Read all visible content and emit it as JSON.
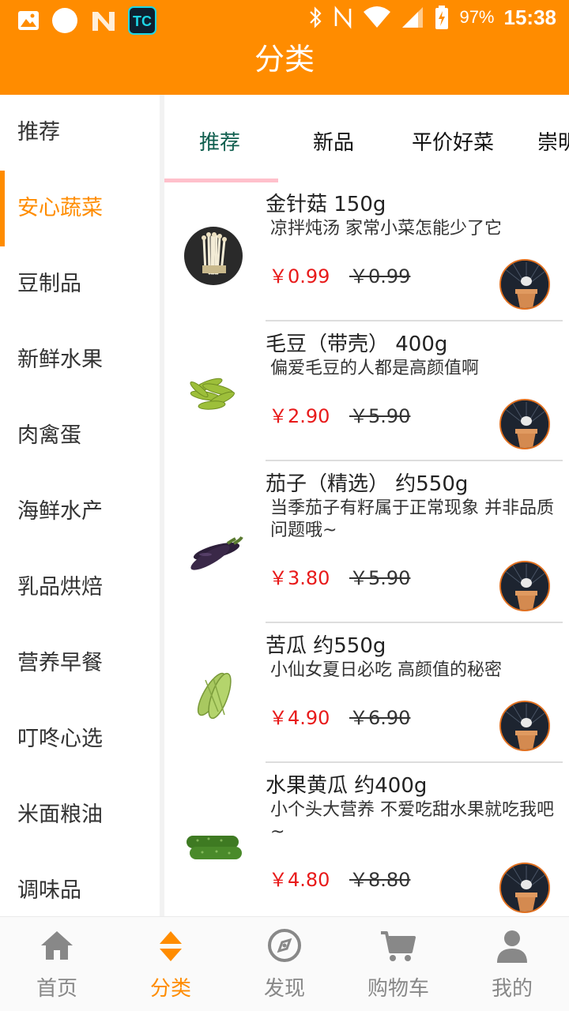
{
  "status_bar": {
    "battery": "97%",
    "time": "15:38"
  },
  "header": {
    "title": "分类"
  },
  "sidebar": {
    "items": [
      {
        "label": "推荐",
        "active": false
      },
      {
        "label": "安心蔬菜",
        "active": true
      },
      {
        "label": "豆制品",
        "active": false
      },
      {
        "label": "新鲜水果",
        "active": false
      },
      {
        "label": "肉禽蛋",
        "active": false
      },
      {
        "label": "海鲜水产",
        "active": false
      },
      {
        "label": "乳品烘焙",
        "active": false
      },
      {
        "label": "营养早餐",
        "active": false
      },
      {
        "label": "叮咚心选",
        "active": false
      },
      {
        "label": "米面粮油",
        "active": false
      },
      {
        "label": "调味品",
        "active": false
      }
    ]
  },
  "tabs": [
    {
      "label": "推荐",
      "active": true
    },
    {
      "label": "新品",
      "active": false
    },
    {
      "label": "平价好菜",
      "active": false
    },
    {
      "label": "崇明",
      "active": false
    }
  ],
  "products": [
    {
      "name": "金针菇 150g",
      "desc": "凉拌炖汤 家常小菜怎能少了它",
      "price": "￥0.99",
      "old_price": "￥0.99",
      "image": "enoki-mushroom-image"
    },
    {
      "name": "毛豆（带壳） 400g",
      "desc": "偏爱毛豆的人都是高颜值啊",
      "price": "￥2.90",
      "old_price": "￥5.90",
      "image": "edamame-image"
    },
    {
      "name": "茄子（精选） 约550g",
      "desc": "当季茄子有籽属于正常现象 并非品质问题哦~",
      "price": "￥3.80",
      "old_price": "￥5.90",
      "image": "eggplant-image"
    },
    {
      "name": "苦瓜 约550g",
      "desc": "小仙女夏日必吃 高颜值的秘密",
      "price": "￥4.90",
      "old_price": "￥6.90",
      "image": "bitter-melon-image"
    },
    {
      "name": "水果黄瓜 约400g",
      "desc": "小个头大营养 不爱吃甜水果就吃我吧~",
      "price": "￥4.80",
      "old_price": "￥8.80",
      "image": "cucumber-image"
    }
  ],
  "bottom_nav": [
    {
      "label": "首页",
      "icon": "home-icon",
      "active": false
    },
    {
      "label": "分类",
      "icon": "sort-icon",
      "active": true
    },
    {
      "label": "发现",
      "icon": "compass-icon",
      "active": false
    },
    {
      "label": "购物车",
      "icon": "cart-icon",
      "active": false
    },
    {
      "label": "我的",
      "icon": "user-icon",
      "active": false
    }
  ],
  "colors": {
    "brand": "#FF8C00",
    "price": "#E81A1A",
    "active_tab": "#0F5E4E",
    "tab_underline": "#FFC0CB"
  }
}
